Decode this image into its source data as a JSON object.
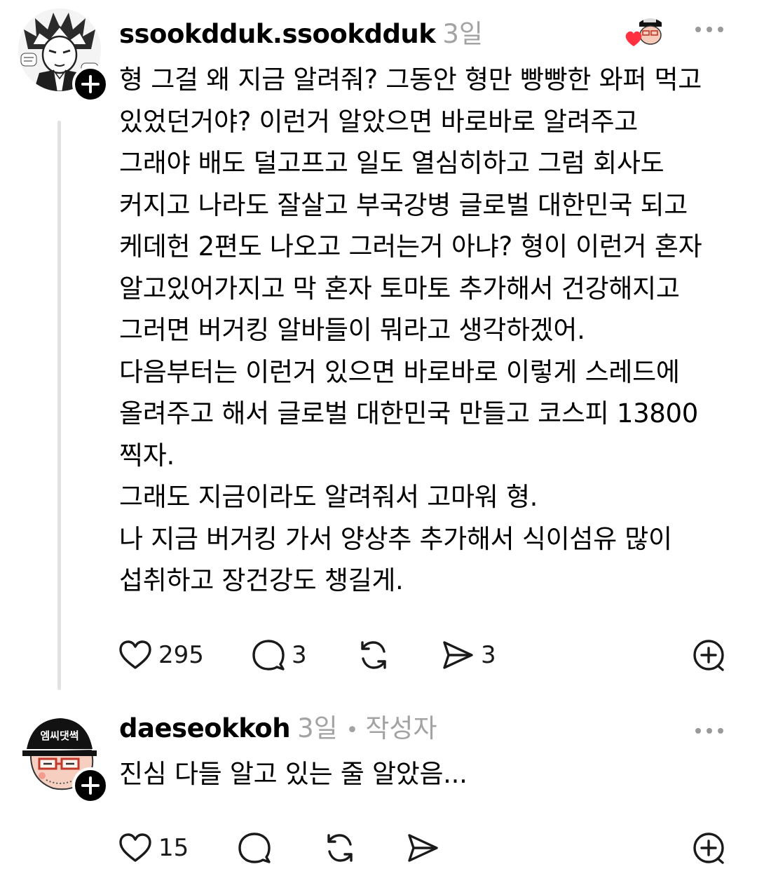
{
  "comments": [
    {
      "username": "ssookdduk.ssookdduk",
      "timestamp": "3일",
      "avatar_icon": "manga-character-avatar",
      "liked_by_author_icon": "author-heart-avatar",
      "body_lines": [
        "형 그걸 왜 지금 알려줘? 그동안 형만 빵빵한 와퍼 먹고",
        "있었던거야? 이런거 알았으면 바로바로 알려주고",
        "그래야 배도 덜고프고 일도 열심히하고 그럼 회사도",
        "커지고 나라도 잘살고 부국강병 글로벌 대한민국 되고",
        "케데헌 2편도 나오고 그러는거 아냐? 형이 이런거 혼자",
        "알고있어가지고 막 혼자 토마토 추가해서 건강해지고",
        "그러면 버거킹 알바들이 뭐라고 생각하겠어.",
        "다음부터는 이런거 있으면 바로바로 이렇게 스레드에",
        "올려주고 해서 글로벌 대한민국 만들고 코스피 13800",
        "찍자.",
        "그래도 지금이라도 알려줘서 고마워 형.",
        "나 지금 버거킹 가서 양상추 추가해서 식이섬유 많이",
        "섭취하고 장건강도 챙길게."
      ],
      "actions": {
        "likes": "295",
        "replies": "3",
        "reposts": "",
        "shares": "3"
      }
    },
    {
      "username": "daeseokkoh",
      "timestamp": "3일",
      "separator": "•",
      "author_tag": "작성자",
      "avatar_icon": "cartoon-cap-glasses-avatar",
      "cap_text": "엠씨댓썩",
      "body_lines": [
        "진심 다들 알고 있는 줄 알았음..."
      ],
      "actions": {
        "likes": "15",
        "replies": "",
        "reposts": "",
        "shares": ""
      }
    }
  ],
  "colors": {
    "text": "#000000",
    "muted": "#a3a3a3",
    "thread_line": "#e2e2e2",
    "heart_red": "#ff3040"
  }
}
